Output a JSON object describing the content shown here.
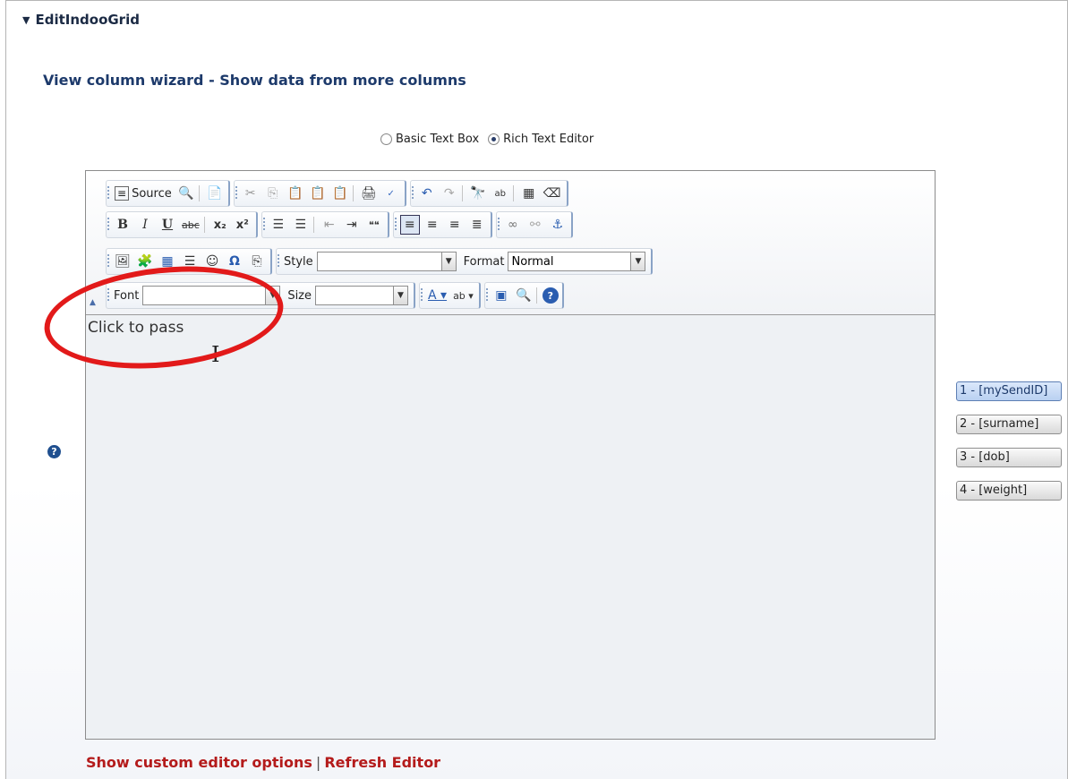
{
  "section": {
    "title": "EditIndooGrid"
  },
  "wizard": {
    "title": "View column wizard - Show data from more columns"
  },
  "mode": {
    "options": [
      {
        "label": "Basic Text Box",
        "selected": false
      },
      {
        "label": "Rich Text Editor",
        "selected": true
      }
    ]
  },
  "toolbar": {
    "source_label": "Source",
    "style_label": "Style",
    "style_value": "",
    "format_label": "Format",
    "format_value": "Normal",
    "font_label": "Font",
    "font_value": "",
    "size_label": "Size",
    "size_value": "",
    "bold": "B",
    "italic": "I",
    "underline": "U",
    "strike": "abc",
    "subscript": "x₂",
    "superscript": "x²",
    "blockquote": "❝❝",
    "special_char": "Ω",
    "help": "?"
  },
  "editor": {
    "content": "Click to pass"
  },
  "fields": [
    "1 - [mySendID]",
    "2 - [surname]",
    "3 - [dob]",
    "4 - [weight]"
  ],
  "links": {
    "custom_options": "Show custom editor options",
    "separator": "|",
    "refresh": "Refresh Editor"
  },
  "colors": {
    "accent": "#1d3a6b",
    "link": "#b41b1b",
    "annotation": "#e21a1a"
  }
}
